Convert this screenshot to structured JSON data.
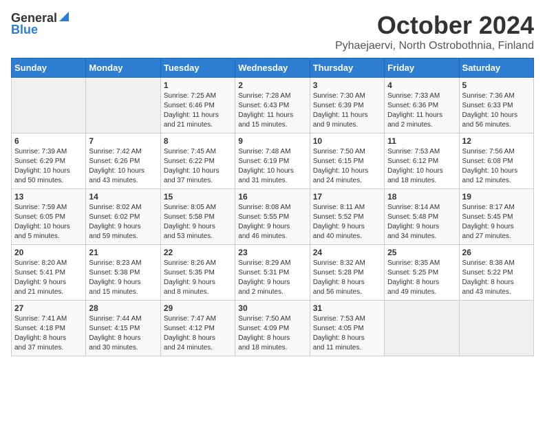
{
  "logo": {
    "general": "General",
    "blue": "Blue"
  },
  "title": "October 2024",
  "location": "Pyhaejaervi, North Ostrobothnia, Finland",
  "days_header": [
    "Sunday",
    "Monday",
    "Tuesday",
    "Wednesday",
    "Thursday",
    "Friday",
    "Saturday"
  ],
  "weeks": [
    [
      {
        "day": "",
        "info": ""
      },
      {
        "day": "",
        "info": ""
      },
      {
        "day": "1",
        "info": "Sunrise: 7:25 AM\nSunset: 6:46 PM\nDaylight: 11 hours\nand 21 minutes."
      },
      {
        "day": "2",
        "info": "Sunrise: 7:28 AM\nSunset: 6:43 PM\nDaylight: 11 hours\nand 15 minutes."
      },
      {
        "day": "3",
        "info": "Sunrise: 7:30 AM\nSunset: 6:39 PM\nDaylight: 11 hours\nand 9 minutes."
      },
      {
        "day": "4",
        "info": "Sunrise: 7:33 AM\nSunset: 6:36 PM\nDaylight: 11 hours\nand 2 minutes."
      },
      {
        "day": "5",
        "info": "Sunrise: 7:36 AM\nSunset: 6:33 PM\nDaylight: 10 hours\nand 56 minutes."
      }
    ],
    [
      {
        "day": "6",
        "info": "Sunrise: 7:39 AM\nSunset: 6:29 PM\nDaylight: 10 hours\nand 50 minutes."
      },
      {
        "day": "7",
        "info": "Sunrise: 7:42 AM\nSunset: 6:26 PM\nDaylight: 10 hours\nand 43 minutes."
      },
      {
        "day": "8",
        "info": "Sunrise: 7:45 AM\nSunset: 6:22 PM\nDaylight: 10 hours\nand 37 minutes."
      },
      {
        "day": "9",
        "info": "Sunrise: 7:48 AM\nSunset: 6:19 PM\nDaylight: 10 hours\nand 31 minutes."
      },
      {
        "day": "10",
        "info": "Sunrise: 7:50 AM\nSunset: 6:15 PM\nDaylight: 10 hours\nand 24 minutes."
      },
      {
        "day": "11",
        "info": "Sunrise: 7:53 AM\nSunset: 6:12 PM\nDaylight: 10 hours\nand 18 minutes."
      },
      {
        "day": "12",
        "info": "Sunrise: 7:56 AM\nSunset: 6:08 PM\nDaylight: 10 hours\nand 12 minutes."
      }
    ],
    [
      {
        "day": "13",
        "info": "Sunrise: 7:59 AM\nSunset: 6:05 PM\nDaylight: 10 hours\nand 5 minutes."
      },
      {
        "day": "14",
        "info": "Sunrise: 8:02 AM\nSunset: 6:02 PM\nDaylight: 9 hours\nand 59 minutes."
      },
      {
        "day": "15",
        "info": "Sunrise: 8:05 AM\nSunset: 5:58 PM\nDaylight: 9 hours\nand 53 minutes."
      },
      {
        "day": "16",
        "info": "Sunrise: 8:08 AM\nSunset: 5:55 PM\nDaylight: 9 hours\nand 46 minutes."
      },
      {
        "day": "17",
        "info": "Sunrise: 8:11 AM\nSunset: 5:52 PM\nDaylight: 9 hours\nand 40 minutes."
      },
      {
        "day": "18",
        "info": "Sunrise: 8:14 AM\nSunset: 5:48 PM\nDaylight: 9 hours\nand 34 minutes."
      },
      {
        "day": "19",
        "info": "Sunrise: 8:17 AM\nSunset: 5:45 PM\nDaylight: 9 hours\nand 27 minutes."
      }
    ],
    [
      {
        "day": "20",
        "info": "Sunrise: 8:20 AM\nSunset: 5:41 PM\nDaylight: 9 hours\nand 21 minutes."
      },
      {
        "day": "21",
        "info": "Sunrise: 8:23 AM\nSunset: 5:38 PM\nDaylight: 9 hours\nand 15 minutes."
      },
      {
        "day": "22",
        "info": "Sunrise: 8:26 AM\nSunset: 5:35 PM\nDaylight: 9 hours\nand 8 minutes."
      },
      {
        "day": "23",
        "info": "Sunrise: 8:29 AM\nSunset: 5:31 PM\nDaylight: 9 hours\nand 2 minutes."
      },
      {
        "day": "24",
        "info": "Sunrise: 8:32 AM\nSunset: 5:28 PM\nDaylight: 8 hours\nand 56 minutes."
      },
      {
        "day": "25",
        "info": "Sunrise: 8:35 AM\nSunset: 5:25 PM\nDaylight: 8 hours\nand 49 minutes."
      },
      {
        "day": "26",
        "info": "Sunrise: 8:38 AM\nSunset: 5:22 PM\nDaylight: 8 hours\nand 43 minutes."
      }
    ],
    [
      {
        "day": "27",
        "info": "Sunrise: 7:41 AM\nSunset: 4:18 PM\nDaylight: 8 hours\nand 37 minutes."
      },
      {
        "day": "28",
        "info": "Sunrise: 7:44 AM\nSunset: 4:15 PM\nDaylight: 8 hours\nand 30 minutes."
      },
      {
        "day": "29",
        "info": "Sunrise: 7:47 AM\nSunset: 4:12 PM\nDaylight: 8 hours\nand 24 minutes."
      },
      {
        "day": "30",
        "info": "Sunrise: 7:50 AM\nSunset: 4:09 PM\nDaylight: 8 hours\nand 18 minutes."
      },
      {
        "day": "31",
        "info": "Sunrise: 7:53 AM\nSunset: 4:05 PM\nDaylight: 8 hours\nand 11 minutes."
      },
      {
        "day": "",
        "info": ""
      },
      {
        "day": "",
        "info": ""
      }
    ]
  ]
}
